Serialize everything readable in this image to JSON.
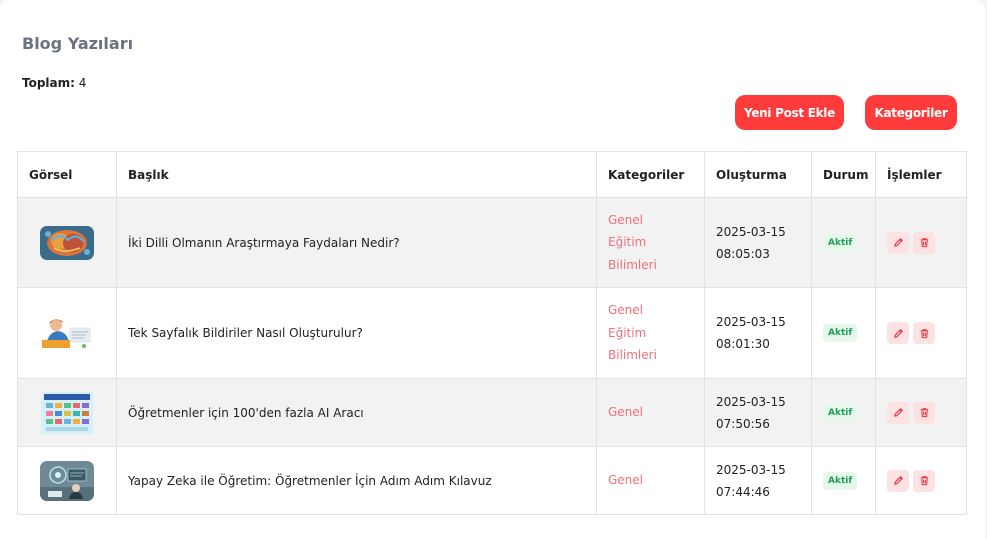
{
  "page": {
    "title": "Blog Yazıları",
    "total_label": "Toplam:",
    "total_value": "4"
  },
  "toolbar": {
    "new_post_label": "Yeni Post Ekle",
    "categories_label": "Kategoriler"
  },
  "table": {
    "headers": {
      "image": "Görsel",
      "title": "Başlık",
      "categories": "Kategoriler",
      "created": "Oluşturma",
      "status": "Durum",
      "actions": "İşlemler"
    },
    "rows": [
      {
        "title": "İki Dilli Olmanın Araştırmaya Faydaları Nedir?",
        "categories": [
          "Genel",
          "Eğitim",
          "Bilimleri"
        ],
        "date": "2025-03-15",
        "time": "08:05:03",
        "status": "Aktif"
      },
      {
        "title": "Tek Sayfalık Bildiriler Nasıl Oluşturulur?",
        "categories": [
          "Genel",
          "Eğitim",
          "Bilimleri"
        ],
        "date": "2025-03-15",
        "time": "08:01:30",
        "status": "Aktif"
      },
      {
        "title": "Öğretmenler için 100'den fazla AI Aracı",
        "categories": [
          "Genel"
        ],
        "date": "2025-03-15",
        "time": "07:50:56",
        "status": "Aktif"
      },
      {
        "title": "Yapay Zeka ile Öğretim: Öğretmenler İçin Adım Adım Kılavuz",
        "categories": [
          "Genel"
        ],
        "date": "2025-03-15",
        "time": "07:44:46",
        "status": "Aktif"
      }
    ]
  },
  "colors": {
    "accent": "#ff3b3b",
    "category_text": "#f0707a",
    "status_bg": "#e6f7ec",
    "status_text": "#1f9d55",
    "action_bg": "#fde2e4",
    "action_icon": "#e53945"
  },
  "icons": {
    "edit": "pencil-icon",
    "delete": "trash-icon"
  }
}
